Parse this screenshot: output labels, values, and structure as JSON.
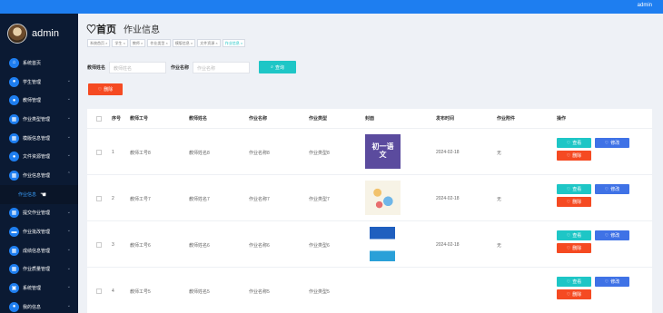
{
  "topbar": {
    "user": "admin"
  },
  "sidebar": {
    "brand": "admin",
    "items": [
      {
        "label": "系统首页",
        "icon": "home-icon",
        "has_arrow": false
      },
      {
        "label": "学生管理",
        "icon": "user-icon",
        "has_arrow": true
      },
      {
        "label": "教师管理",
        "icon": "user-icon",
        "has_arrow": true
      },
      {
        "label": "作业类型管理",
        "icon": "grid-icon",
        "has_arrow": true
      },
      {
        "label": "模版信息管理",
        "icon": "grid-icon",
        "has_arrow": true
      },
      {
        "label": "文件资源管理",
        "icon": "user-icon",
        "has_arrow": true
      },
      {
        "label": "作业信息管理",
        "icon": "grid-icon",
        "has_arrow": true,
        "expanded": true
      },
      {
        "label": "作业信息",
        "sub": true
      },
      {
        "label": "提交作业管理",
        "icon": "grid-icon",
        "has_arrow": true
      },
      {
        "label": "作业批改管理",
        "icon": "chat-icon",
        "has_arrow": true
      },
      {
        "label": "成绩信息管理",
        "icon": "grid-icon",
        "has_arrow": true
      },
      {
        "label": "作业质量管理",
        "icon": "grid-icon",
        "has_arrow": true
      },
      {
        "label": "系统管理",
        "icon": "lock-icon",
        "has_arrow": true
      },
      {
        "label": "我的信息",
        "icon": "user-icon",
        "has_arrow": true
      }
    ]
  },
  "header": {
    "home": "首页",
    "page_title": "作业信息"
  },
  "breadcrumbs": [
    "系统首页 ×",
    "学生 ×",
    "教师 ×",
    "作业类型 ×",
    "模版信息 ×",
    "文件资源 ×",
    "作业信息 ×"
  ],
  "search": {
    "teacher_label": "教师姓名",
    "teacher_placeholder": "教师姓名",
    "hw_label": "作业名称",
    "hw_placeholder": "作业名称",
    "button": "查询"
  },
  "delete_button": "删除",
  "table": {
    "headers": [
      "序号",
      "教师工号",
      "教师姓名",
      "作业名称",
      "作业类型",
      "封面",
      "发布时间",
      "作业附件",
      "操作"
    ],
    "rows": [
      {
        "no": "1",
        "teacher_id": "教师工号8",
        "teacher_name": "教师姓名8",
        "hw_name": "作业名称8",
        "hw_type": "作业类型8",
        "time": "2024-02-18",
        "attachment": "无",
        "cover_text": "初一语文"
      },
      {
        "no": "2",
        "teacher_id": "教师工号7",
        "teacher_name": "教师姓名7",
        "hw_name": "作业名称7",
        "hw_type": "作业类型7",
        "time": "2024-02-18",
        "attachment": "无",
        "cover_text": ""
      },
      {
        "no": "3",
        "teacher_id": "教师工号6",
        "teacher_name": "教师姓名6",
        "hw_name": "作业名称6",
        "hw_type": "作业类型6",
        "time": "2024-02-18",
        "attachment": "无",
        "cover_text": ""
      },
      {
        "no": "4",
        "teacher_id": "教师工号5",
        "teacher_name": "教师姓名5",
        "hw_name": "作业名称5",
        "hw_type": "作业类型5",
        "time": "",
        "attachment": "",
        "cover_text": ""
      }
    ],
    "actions": {
      "view": "查看",
      "edit": "修改",
      "delete": "删除"
    }
  },
  "colors": {
    "primary": "#1e7ef0",
    "cyan": "#1ec6c6",
    "red": "#f54a22",
    "blue": "#3f72e6",
    "sidebar": "#0b1a33"
  }
}
